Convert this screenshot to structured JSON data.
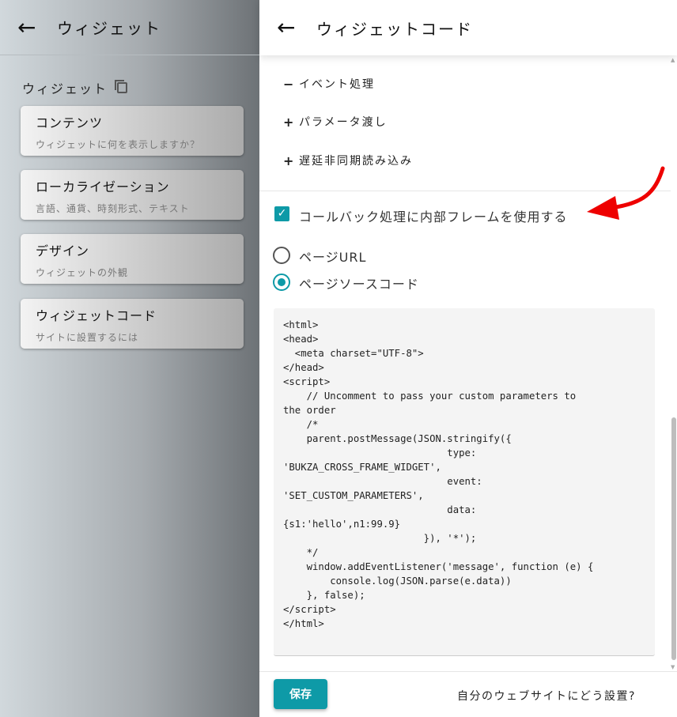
{
  "left": {
    "title": "ウィジェット",
    "section": "ウィジェット",
    "cards": [
      {
        "title": "コンテンツ",
        "subtitle": "ウィジェットに何を表示しますか？"
      },
      {
        "title": "ローカライゼーション",
        "subtitle": "言語、通貨、時刻形式、テキスト"
      },
      {
        "title": "デザイン",
        "subtitle": "ウィジェットの外観"
      },
      {
        "title": "ウィジェットコード",
        "subtitle": "サイトに設置するには"
      }
    ]
  },
  "right": {
    "title": "ウィジェットコード",
    "accordion": [
      {
        "icon": "−",
        "label": "イベント処理"
      },
      {
        "icon": "+",
        "label": "パラメータ渡し"
      },
      {
        "icon": "+",
        "label": "遅延非同期読み込み"
      }
    ],
    "checkbox": {
      "label": "コールバック処理に内部フレームを使用する",
      "checked": true
    },
    "radios": [
      {
        "label": "ページURL",
        "selected": false
      },
      {
        "label": "ページソースコード",
        "selected": true
      }
    ],
    "code": "<html>\n<head>\n  <meta charset=\"UTF-8\">\n</head>\n<script>\n    // Uncomment to pass your custom parameters to\nthe order\n    /*\n    parent.postMessage(JSON.stringify({\n                            type:\n'BUKZA_CROSS_FRAME_WIDGET',\n                            event:\n'SET_CUSTOM_PARAMETERS',\n                            data:\n{s1:'hello',n1:99.9}\n                        }), '*');\n    */\n    window.addEventListener('message', function (e) {\n        console.log(JSON.parse(e.data))\n    }, false);\n</script>\n</html>",
    "save": "保存",
    "how": "自分のウェブサイトにどう設置?"
  },
  "colors": {
    "accent": "#0e9aa7",
    "arrow": "#ee0000"
  }
}
